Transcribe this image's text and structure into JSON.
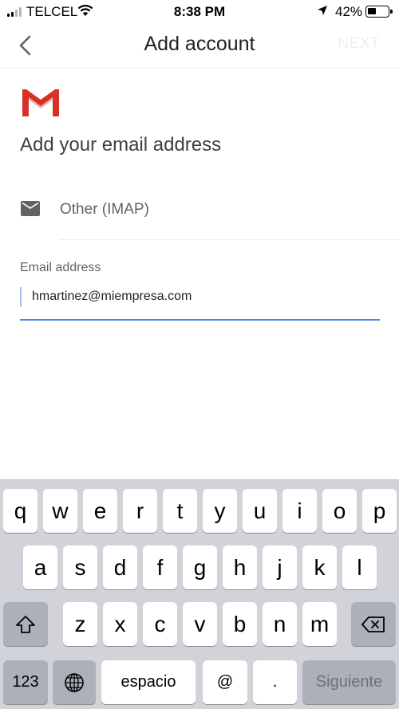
{
  "status_bar": {
    "carrier": "TELCEL",
    "time": "8:38 PM",
    "battery_percent": "42%",
    "battery_level": 0.42,
    "icons": [
      "signal-icon",
      "wifi-icon",
      "location-arrow-icon",
      "battery-icon"
    ]
  },
  "app_bar": {
    "title": "Add account",
    "next_label": "NEXT",
    "back_icon": "chevron-left-icon"
  },
  "content": {
    "logo": "gmail-logo",
    "heading": "Add your email address",
    "provider": {
      "icon": "mail-icon",
      "label": "Other (IMAP)"
    },
    "email_field": {
      "label": "Email address",
      "value": "hmartinez@miempresa.com"
    }
  },
  "colors": {
    "accent": "#4a86e0",
    "gmail_red": "#d93025",
    "keyboard_bg": "#d1d3d9",
    "function_key": "#abb0bb"
  },
  "keyboard": {
    "row1": [
      "q",
      "w",
      "e",
      "r",
      "t",
      "y",
      "u",
      "i",
      "o",
      "p"
    ],
    "row2": [
      "a",
      "s",
      "d",
      "f",
      "g",
      "h",
      "j",
      "k",
      "l"
    ],
    "row3": [
      "z",
      "x",
      "c",
      "v",
      "b",
      "n",
      "m"
    ],
    "numbers_key": "123",
    "space_key": "espacio",
    "at_key": "@",
    "dot_key": ".",
    "return_key": "Siguiente",
    "shift_icon": "shift-icon",
    "globe_icon": "globe-icon",
    "delete_icon": "backspace-icon"
  }
}
